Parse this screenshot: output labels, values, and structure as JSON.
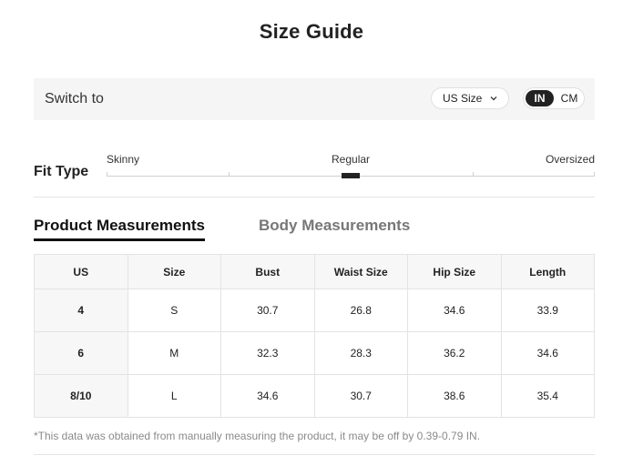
{
  "title": "Size Guide",
  "switch_bar": {
    "label": "Switch to",
    "size_select": "US Size",
    "units": [
      "IN",
      "CM"
    ],
    "active_unit": "IN"
  },
  "fit_type": {
    "label": "Fit Type",
    "options": [
      "Skinny",
      "Regular",
      "Oversized"
    ],
    "selected": "Regular"
  },
  "tabs": [
    {
      "label": "Product Measurements",
      "active": true
    },
    {
      "label": "Body Measurements",
      "active": false
    }
  ],
  "table": {
    "headers": [
      "US",
      "Size",
      "Bust",
      "Waist Size",
      "Hip Size",
      "Length"
    ],
    "rows": [
      [
        "4",
        "S",
        "30.7",
        "26.8",
        "34.6",
        "33.9"
      ],
      [
        "6",
        "M",
        "32.3",
        "28.3",
        "36.2",
        "34.6"
      ],
      [
        "8/10",
        "L",
        "34.6",
        "30.7",
        "38.6",
        "35.4"
      ]
    ]
  },
  "footnote": "*This data was obtained from manually measuring the product, it may be off by 0.39-0.79 IN.",
  "colors": {
    "accent": "#222222",
    "muted": "#8a8a8a",
    "panel": "#f5f5f5"
  }
}
